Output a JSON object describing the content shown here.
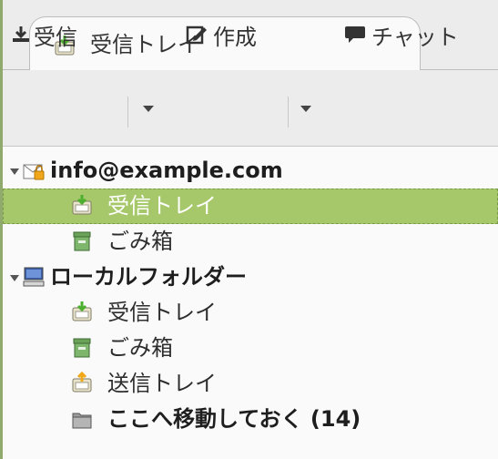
{
  "tab": {
    "label": "受信トレイ",
    "icon": "inbox-icon"
  },
  "toolbar": {
    "get_messages": "受信",
    "write": "作成",
    "chat": "チャット"
  },
  "folders": {
    "account": "info@example.com",
    "account_inbox": "受信トレイ",
    "account_trash": "ごみ箱",
    "local": "ローカルフォルダー",
    "local_inbox": "受信トレイ",
    "local_trash": "ごみ箱",
    "local_outbox": "送信トレイ",
    "archive": "ここへ移動しておく (14)"
  },
  "colors": {
    "selection": "#a6c86a",
    "accent_border": "#8faa6c"
  }
}
